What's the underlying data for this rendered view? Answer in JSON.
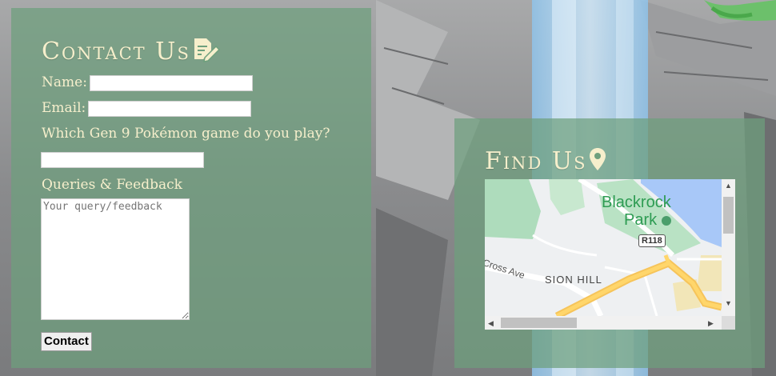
{
  "contact": {
    "title": "Contact Us",
    "name_label": "Name:",
    "name_value": "",
    "email_label": "Email:",
    "email_value": "",
    "game_question": "Which Gen 9 Pokémon game do you play?",
    "game_value": "",
    "queries_label": "Queries & Feedback",
    "query_placeholder": "Your query/feedback",
    "submit_label": "Contact"
  },
  "find": {
    "title": "Find Us",
    "map": {
      "park_label_line1": "Blackrock",
      "park_label_line2": "Park",
      "road_badge": "R118",
      "street_label": "Cross Ave",
      "area_label": "SION HILL"
    }
  },
  "colors": {
    "panel": "#6ea07d",
    "title_text": "#f6efcc"
  },
  "icons": {
    "contact": "edit-note-icon",
    "find": "map-pin-icon"
  }
}
